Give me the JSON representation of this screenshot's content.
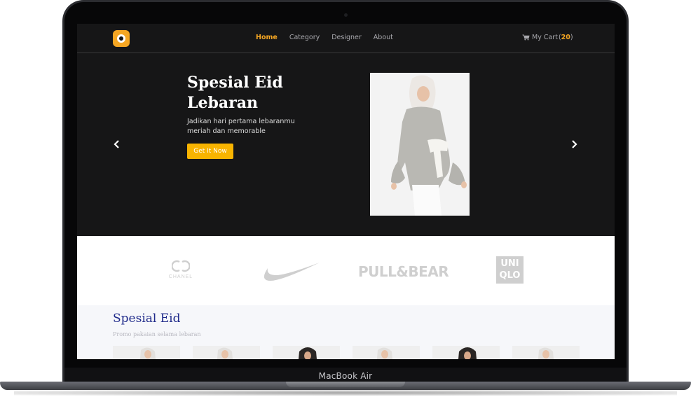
{
  "device": {
    "label": "MacBook Air"
  },
  "nav": {
    "links": [
      {
        "label": "Home",
        "active": true
      },
      {
        "label": "Category",
        "active": false
      },
      {
        "label": "Designer",
        "active": false
      },
      {
        "label": "About",
        "active": false
      }
    ],
    "cart_label": "My Cart",
    "cart_open": "(",
    "cart_count": "20",
    "cart_close": ")"
  },
  "hero": {
    "title": "Spesial Eid Lebaran",
    "subtitle": "Jadikan hari pertama lebaranmu meriah dan memorable",
    "cta_label": "Get It Now"
  },
  "brands": {
    "chanel_label": "CHANEL",
    "pullbear_label": "PULL&BEAR",
    "uniqlo_top": "UNI",
    "uniqlo_bottom": "QLO"
  },
  "promo": {
    "title": "Spesial Eid",
    "subtitle": "Promo pakaian selama lebaran"
  },
  "colors": {
    "accent": "#f5a623",
    "button": "#f8b400",
    "hero_bg": "#161617",
    "promo_title": "#1f2a8a"
  }
}
